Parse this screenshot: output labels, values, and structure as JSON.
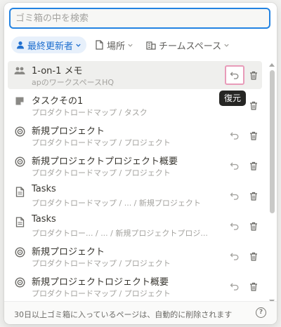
{
  "search": {
    "placeholder": "ゴミ箱の中を検索",
    "value": ""
  },
  "filters": [
    {
      "label": "最終更新者",
      "icon": "person-icon",
      "active": true
    },
    {
      "label": "場所",
      "icon": "page-icon",
      "active": false
    },
    {
      "label": "チームスペース",
      "icon": "building-icon",
      "active": false
    }
  ],
  "items": [
    {
      "title": "1-on-1 メモ",
      "path": "apのワークスペースHQ",
      "icon": "people-icon"
    },
    {
      "title": "タスクその1",
      "path": "プロダクトロードマップ / タスク",
      "icon": "note-icon"
    },
    {
      "title": "新規プロジェクト",
      "path": "プロダクトロードマップ / プロジェクト",
      "icon": "target-icon"
    },
    {
      "title": "新規プロジェクトプロジェクト概要",
      "path": "プロダクトロードマップ / プロジェクト",
      "icon": "target-icon"
    },
    {
      "title": "Tasks",
      "path": "プロダクトロードマップ / ... / 新規プロジェクト",
      "icon": "page-icon"
    },
    {
      "title": "Tasks",
      "path": "プロダクトロー...  / ... / 新規プロジェクトプロジ...",
      "icon": "page-icon"
    },
    {
      "title": "新規プロジェクト",
      "path": "プロダクトロードマップ / プロジェクト",
      "icon": "target-icon"
    },
    {
      "title": "新規プロジェクトロジェクト概要",
      "path": "プロダクトロードマップ / プロジェクト",
      "icon": "target-icon"
    }
  ],
  "tooltip": "復元",
  "footer": {
    "note": "30日以上ゴミ箱に入っているページは、自動的に削除されます",
    "help": "?"
  },
  "colors": {
    "accent": "#2383e2",
    "highlight": "#e89bb9",
    "chip_bg": "#e7f0fb"
  }
}
